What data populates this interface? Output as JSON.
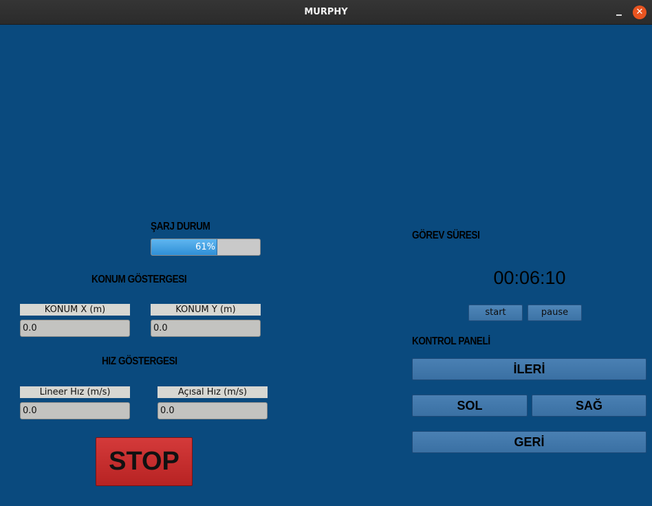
{
  "window": {
    "title": "MURPHY",
    "minimize_icon": "minimize-icon",
    "close_icon": "close-icon",
    "close_glyph": "✕"
  },
  "battery": {
    "heading": "ŞARJ DURUM",
    "percent": 61,
    "percent_text": "61%"
  },
  "position": {
    "heading": "KONUM GÖSTERGESI",
    "x_label": "KONUM X (m)",
    "x_value": "0.0",
    "y_label": "KONUM Y (m)",
    "y_value": "0.0"
  },
  "speed": {
    "heading": "HIZ GÖSTERGESI",
    "linear_label": "Lineer Hız (m/s)",
    "linear_value": "0.0",
    "angular_label": "Açısal Hız (m/s)",
    "angular_value": "0.0"
  },
  "stop": {
    "label": "STOP"
  },
  "mission": {
    "heading": "GÖREV SÜRESI",
    "time": "00:06:10",
    "start_label": "start",
    "pause_label": "pause"
  },
  "control": {
    "heading": "KONTROL PANELİ",
    "forward_label": "İLERİ",
    "left_label": "SOL",
    "right_label": "SAĞ",
    "back_label": "GERİ"
  },
  "colors": {
    "background": "#0a4a7e",
    "stop": "#c62f2f",
    "progress": "#3c9be0",
    "close": "#e95420"
  }
}
